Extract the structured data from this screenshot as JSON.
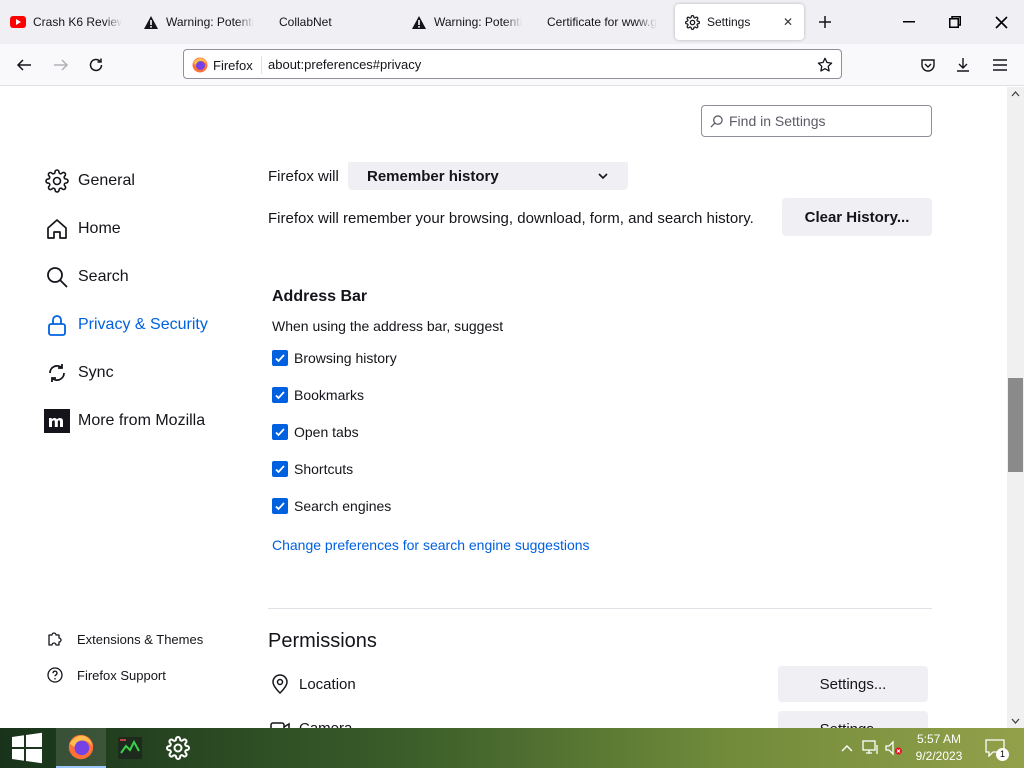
{
  "browser": {
    "tabs": [
      {
        "title": "Crash K6 Review",
        "icon": "youtube-icon"
      },
      {
        "title": "Warning: Potenti",
        "icon": "warning-icon"
      },
      {
        "title": "CollabNet",
        "icon": "none"
      },
      {
        "title": "Warning: Potenti",
        "icon": "warning-icon"
      },
      {
        "title": "Certificate for www.g",
        "icon": "none"
      },
      {
        "title": "Settings",
        "icon": "gear-icon",
        "active": true
      }
    ],
    "identity_label": "Firefox",
    "url": "about:preferences#privacy"
  },
  "settings": {
    "search_placeholder": "Find in Settings",
    "categories": [
      {
        "label": "General",
        "icon": "gear-icon"
      },
      {
        "label": "Home",
        "icon": "home-icon"
      },
      {
        "label": "Search",
        "icon": "search-icon"
      },
      {
        "label": "Privacy & Security",
        "icon": "lock-icon",
        "selected": true
      },
      {
        "label": "Sync",
        "icon": "sync-icon"
      },
      {
        "label": "More from Mozilla",
        "icon": "mozilla-icon"
      }
    ],
    "footer_links": [
      {
        "label": "Extensions & Themes",
        "icon": "puzzle-icon"
      },
      {
        "label": "Firefox Support",
        "icon": "help-icon"
      }
    ],
    "history": {
      "prefix": "Firefox will",
      "mode": "Remember history",
      "description": "Firefox will remember your browsing, download, form, and search history.",
      "clear_button": "Clear History..."
    },
    "address_bar": {
      "heading": "Address Bar",
      "description": "When using the address bar, suggest",
      "options": [
        {
          "label": "Browsing history",
          "checked": true
        },
        {
          "label": "Bookmarks",
          "checked": true
        },
        {
          "label": "Open tabs",
          "checked": true
        },
        {
          "label": "Shortcuts",
          "checked": true
        },
        {
          "label": "Search engines",
          "checked": true
        }
      ],
      "link": "Change preferences for search engine suggestions"
    },
    "permissions": {
      "heading": "Permissions",
      "rows": [
        {
          "label": "Location",
          "icon": "location-icon",
          "button": "Settings..."
        },
        {
          "label": "Camera",
          "icon": "camera-icon",
          "button": "Settings..."
        }
      ]
    }
  },
  "taskbar": {
    "time": "5:57 AM",
    "date": "9/2/2023",
    "notification_count": "1"
  },
  "colors": {
    "accent": "#0061e0",
    "tab_strip": "#f0f0f4",
    "button_bg": "#f0f0f4"
  }
}
